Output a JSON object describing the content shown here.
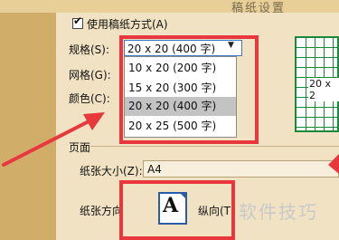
{
  "window": {
    "title": "稿纸设置"
  },
  "grid_paper": {
    "use_label": "使用稿纸方式(A)",
    "checked": true,
    "spec_label": "规格(S):",
    "grid_label": "网格(G):",
    "color_label": "颜色(C):",
    "selected": "20 x 20 (400 字)",
    "options": [
      "10 x 20 (200 字)",
      "15 x 20 (300 字)",
      "20 x 20 (400 字)",
      "20 x 25 (500 字)"
    ],
    "preview_text": "20 x 2",
    "preview_color": "#1a8a3a"
  },
  "page": {
    "section_label": "页面",
    "paper_size_label": "纸张大小(Z):",
    "paper_size_value": "A4",
    "orientation_label": "纸张方向",
    "orientation_value": "纵向(T)",
    "orientation_icon_letter": "A"
  },
  "watermark": "软件技巧",
  "highlight_color": "#e8383d"
}
